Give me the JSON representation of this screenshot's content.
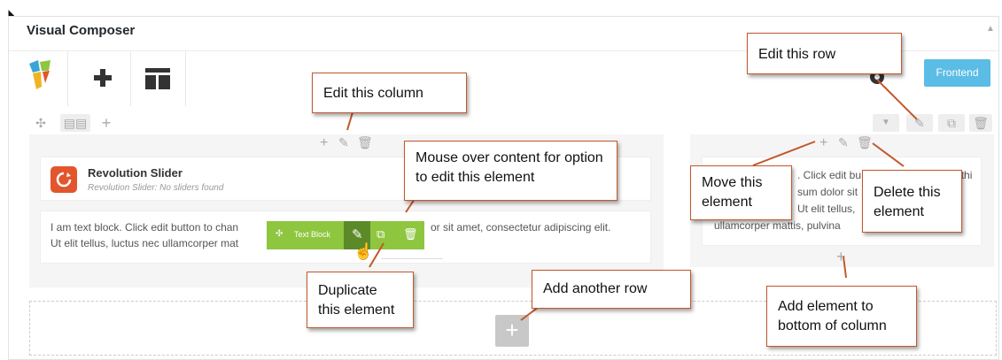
{
  "panel": {
    "title": "Visual Composer"
  },
  "toolbar": {
    "frontend_label": "Frontend"
  },
  "row": {
    "left_column": {
      "slider_title": "Revolution Slider",
      "slider_subtitle": "Revolution Slider: No sliders found",
      "text_block": "I am text block. Click edit button to chan",
      "text_block_after": "or sit amet, consectetur adipiscing elit.",
      "text_line2": "Ut elit tellus, luctus nec ullamcorper mat",
      "hover_label": "Text Block"
    },
    "right_column": {
      "line1": ". Click edit bu",
      "line1b": "change thi",
      "line2": "sum dolor sit",
      "line3": "Ut elit tellus,",
      "line4": "ullamcorper mattis, pulvina"
    }
  },
  "callouts": {
    "edit_row": "Edit this row",
    "edit_column": "Edit this column",
    "mouse_over": "Mouse over content for option to edit this element",
    "move_element": "Move this element",
    "delete_element": "Delete this element",
    "duplicate_element": "Duplicate this element",
    "add_row": "Add another row",
    "add_bottom": "Add element to bottom of column"
  },
  "colors": {
    "accent_green": "#8ec63f",
    "frontend_blue": "#5bbce6",
    "slider_orange": "#e2562d",
    "callout_border": "#c2572b"
  },
  "icons": [
    "cursor-icon",
    "vc-logo-icon",
    "add-element-icon",
    "templates-icon",
    "gear-icon",
    "move-row-icon",
    "layout-icon",
    "add-column-icon",
    "collapse-icon",
    "edit-icon",
    "clone-icon",
    "delete-icon",
    "refresh-icon",
    "hand-pointer-icon"
  ]
}
